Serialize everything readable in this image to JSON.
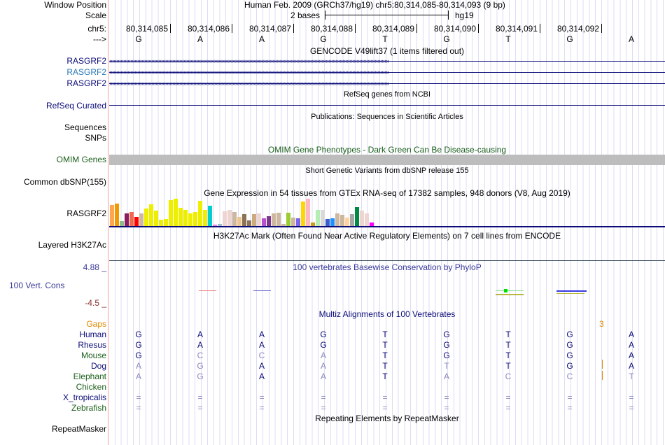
{
  "header": {
    "window_position_label": "Window Position",
    "window_position": "Human Feb. 2009 (GRCh37/hg19)   chr5:80,314,085-80,314,093 (9 bp)",
    "scale_label": "Scale",
    "scale_text": "2 bases",
    "scale_assembly": "hg19",
    "chrom_label": "chr5:",
    "strand_label": "--->",
    "positions": [
      "80,314,085",
      "80,314,086",
      "80,314,087",
      "80,314,088",
      "80,314,089",
      "80,314,090",
      "80,314,091",
      "80,314,092"
    ],
    "bases": [
      "G",
      "A",
      "A",
      "G",
      "T",
      "G",
      "T",
      "G",
      "A"
    ]
  },
  "tracks": {
    "gencode": {
      "title": "GENCODE V49lift37 (1 items filtered out)",
      "items": [
        {
          "label": "RASGRF2",
          "color": "#0c0c78"
        },
        {
          "label": "RASGRF2",
          "color": "#2a7ab8"
        },
        {
          "label": "RASGRF2",
          "color": "#0c0c78"
        }
      ]
    },
    "refseq": {
      "title": "RefSeq genes from NCBI",
      "label": "RefSeq Curated"
    },
    "publications": {
      "title": "Publications: Sequences in Scientific Articles",
      "labels": [
        "Sequences",
        "SNPs"
      ]
    },
    "omim": {
      "title": "OMIM Gene Phenotypes - Dark Green Can Be Disease-causing",
      "label": "OMIM Genes"
    },
    "dbsnp": {
      "title": "Short Genetic Variants from dbSNP release 155",
      "label": "Common dbSNP(155)"
    },
    "gtex": {
      "title": "Gene Expression in 54 tissues from GTEx RNA-seq of 17382 samples, 948 donors (V8, Aug 2019)",
      "label": "RASGRF2",
      "values": [
        92,
        97,
        22,
        55,
        61,
        40,
        55,
        76,
        94,
        67,
        28,
        31,
        112,
        118,
        79,
        70,
        55,
        61,
        109,
        70,
        88,
        7,
        10,
        64,
        70,
        61,
        40,
        52,
        25,
        52,
        55,
        34,
        43,
        55,
        58,
        10,
        58,
        37,
        34,
        106,
        118,
        16,
        70,
        70,
        31,
        34,
        55,
        49,
        37,
        52,
        82,
        67,
        55,
        16
      ],
      "colors": [
        "#FFA54F",
        "#EE9A00",
        "#8FBC8F",
        "#8B1C62",
        "#EE6A50",
        "#FF0000",
        "#CDB79E",
        "#EEEE00",
        "#EEEE00",
        "#EEEE00",
        "#EEEE00",
        "#EEEE00",
        "#EEEE00",
        "#EEEE00",
        "#EEEE00",
        "#EEEE00",
        "#EEEE00",
        "#EEEE00",
        "#EEEE00",
        "#EEEE00",
        "#00CED1",
        "#EE82EE",
        "#9AC0CD",
        "#EED5D2",
        "#EED5D2",
        "#CDB79E",
        "#EEC591",
        "#8B7355",
        "#8B7355",
        "#CDAA7D",
        "#EED5D2",
        "#B452CD",
        "#7A378B",
        "#CDB79E",
        "#CDB79E",
        "#CDB79E",
        "#9ACD32",
        "#CDB79E",
        "#7A67EE",
        "#FFD700",
        "#FFB6C1",
        "#CD9B1D",
        "#B4EEB4",
        "#D9D9D9",
        "#3A5FCD",
        "#1E90FF",
        "#CDB79E",
        "#CDB79E",
        "#FFD39B",
        "#A6A6A6",
        "#008B45",
        "#EED5D2",
        "#EED5D2",
        "#FF00FF"
      ]
    },
    "h3k27ac": {
      "title": "H3K27Ac Mark (Often Found Near Active Regulatory Elements) on 7 cell lines from ENCODE",
      "label": "Layered H3K27Ac"
    },
    "phylop": {
      "title": "100 vertebrates Basewise Conservation by PhyloP",
      "label": "100 Vert. Cons",
      "max": "4.88 _",
      "min": "-4.5 _"
    },
    "multiz": {
      "title": "Multiz Alignments of 100 Vertebrates",
      "gaps_label": "Gaps",
      "gap_count": "3",
      "species": [
        {
          "name": "Human",
          "color": "navy",
          "bases": [
            "G",
            "A",
            "A",
            "G",
            "T",
            "G",
            "T",
            "G",
            "A"
          ],
          "faint": []
        },
        {
          "name": "Rhesus",
          "color": "navy",
          "bases": [
            "G",
            "A",
            "A",
            "G",
            "T",
            "G",
            "T",
            "G",
            "A"
          ],
          "faint": []
        },
        {
          "name": "Mouse",
          "color": "green",
          "bases": [
            "G",
            "C",
            "C",
            "A",
            "T",
            "G",
            "T",
            "G",
            "A"
          ],
          "faint": [
            1,
            2,
            3
          ]
        },
        {
          "name": "Dog",
          "color": "navy",
          "bases": [
            "A",
            "G",
            "A",
            "A",
            "T",
            "T",
            "T",
            "G",
            "A"
          ],
          "faint": [
            0,
            1,
            3,
            5
          ]
        },
        {
          "name": "Elephant",
          "color": "green",
          "bases": [
            "A",
            "G",
            "A",
            "A",
            "T",
            "A",
            "C",
            "C",
            "T"
          ],
          "faint": [
            0,
            1,
            3,
            5,
            6,
            7,
            8
          ]
        },
        {
          "name": "Chicken",
          "color": "green",
          "bases": [],
          "faint": []
        },
        {
          "name": "X_tropicalis",
          "color": "navy",
          "bases": [
            "=",
            "=",
            "=",
            "=",
            "=",
            "=",
            "=",
            "=",
            "="
          ],
          "faint": [
            0,
            1,
            2,
            3,
            4,
            5,
            6,
            7,
            8
          ]
        },
        {
          "name": "Zebrafish",
          "color": "green",
          "bases": [
            "=",
            "=",
            "=",
            "=",
            "=",
            "=",
            "=",
            "=",
            "="
          ],
          "faint": [
            0,
            1,
            2,
            3,
            4,
            5,
            6,
            7,
            8
          ]
        }
      ]
    },
    "repeatmasker": {
      "title": "Repeating Elements by RepeatMasker",
      "label": "RepeatMasker"
    }
  }
}
